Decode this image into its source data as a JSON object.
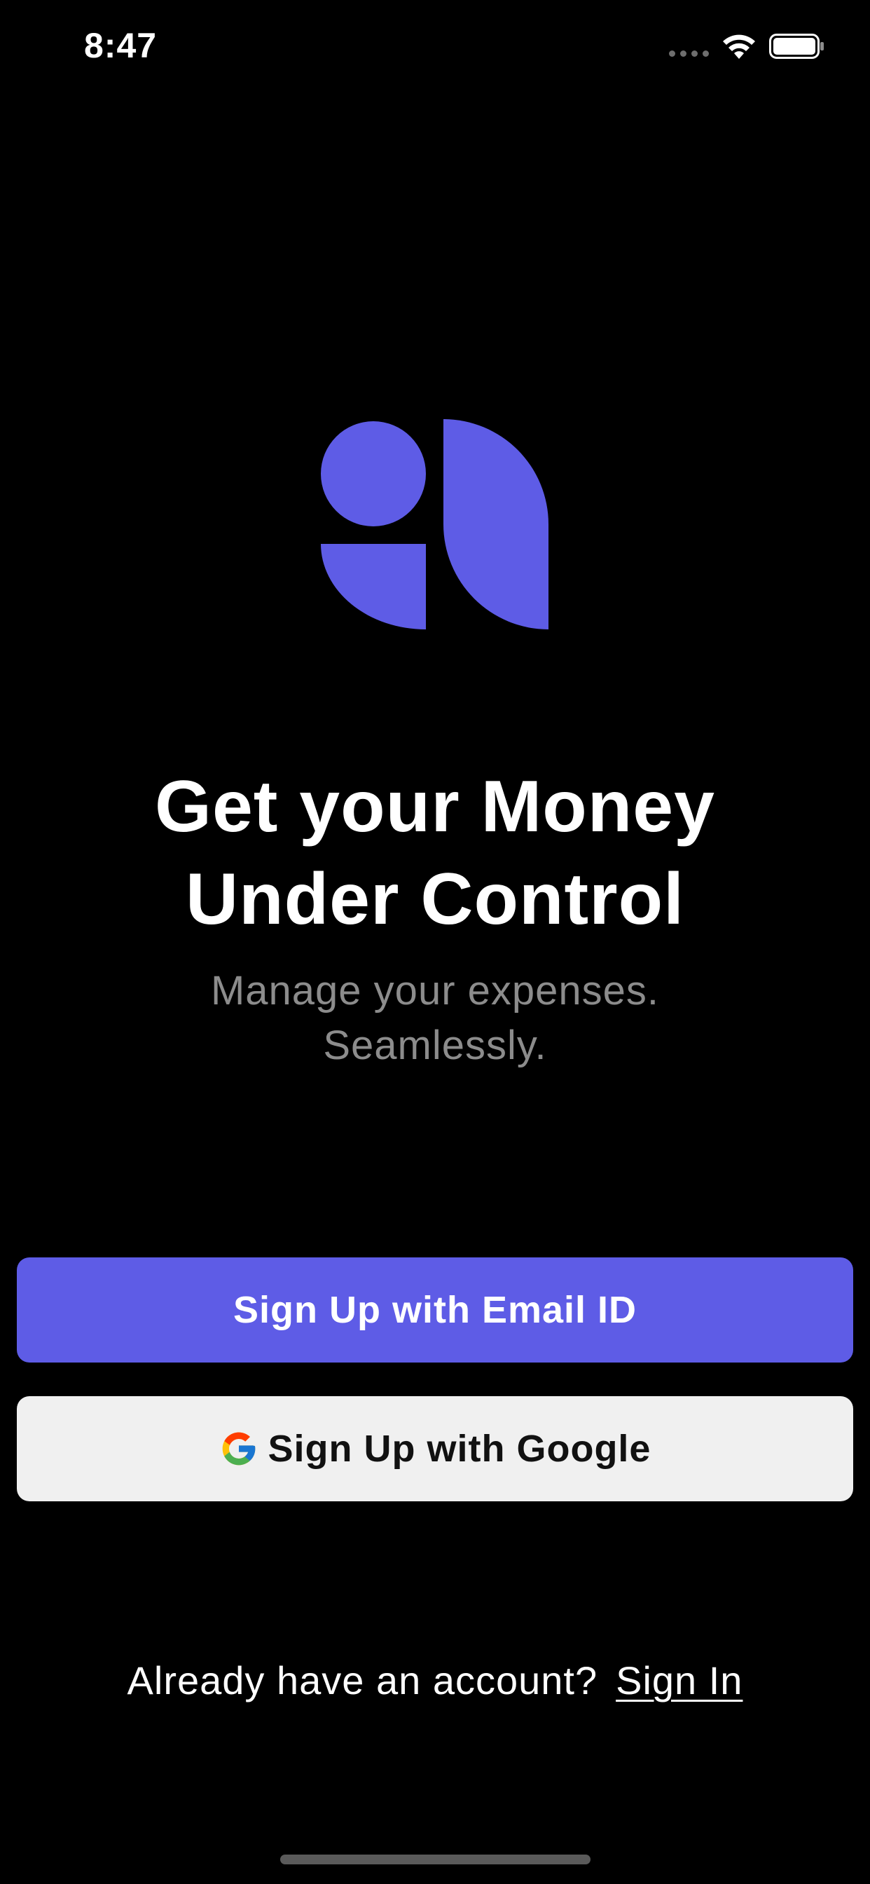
{
  "status_bar": {
    "time": "8:47",
    "signal_icon": "signal-dots-icon",
    "wifi_icon": "wifi-icon",
    "battery_icon": "battery-icon"
  },
  "brand": {
    "logo_icon": "app-logo-icon",
    "accent_color": "#5e5ce6"
  },
  "hero": {
    "title_line1": "Get your Money",
    "title_line2": "Under Control",
    "subtitle_line1": "Manage your expenses.",
    "subtitle_line2": "Seamlessly."
  },
  "actions": {
    "email_label": "Sign Up with Email ID",
    "google_label": "Sign Up with Google",
    "google_icon": "google-icon"
  },
  "footer": {
    "prompt": "Already have an account?",
    "signin_label": "Sign In"
  },
  "colors": {
    "background": "#000000",
    "primary": "#5e5ce6",
    "secondary_button": "#f0f0f0",
    "muted_text": "#8c8c8c"
  }
}
